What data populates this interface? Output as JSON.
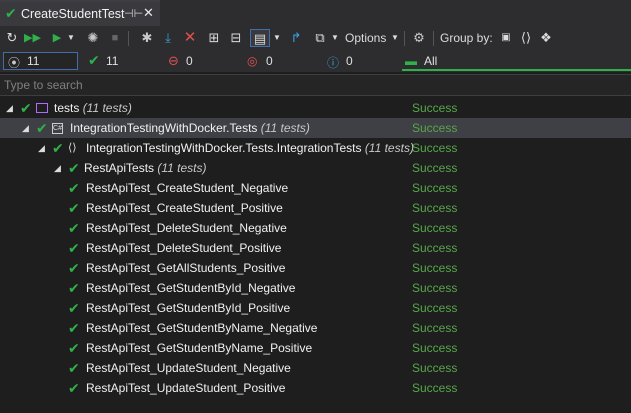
{
  "window": {
    "tab_title": "CreateStudentTest"
  },
  "toolbar": {
    "options_label": "Options",
    "group_by_label": "Group by:"
  },
  "summary": {
    "total": "11",
    "passed": "11",
    "failed": "0",
    "not_run": "0",
    "info": "0",
    "all_label": "All"
  },
  "search": {
    "placeholder": "Type to search"
  },
  "colors": {
    "success": "#57a64a",
    "pass_check": "#2fb14a",
    "selected_row": "#3f3f46"
  },
  "tree": [
    {
      "level": 0,
      "name": "tests",
      "count": "(11 tests)",
      "status": "Success",
      "icon": "project-icon",
      "expandable": true,
      "selected": false
    },
    {
      "level": 1,
      "name": "IntegrationTestingWithDocker.Tests",
      "count": "(11 tests)",
      "status": "Success",
      "icon": "csharp-project-icon",
      "expandable": true,
      "selected": true
    },
    {
      "level": 2,
      "name": "IntegrationTestingWithDocker.Tests.IntegrationTests",
      "count": "(11 tests)",
      "status": "Success",
      "icon": "namespace-icon",
      "expandable": true,
      "selected": false
    },
    {
      "level": 3,
      "name": "RestApiTests",
      "count": "(11 tests)",
      "status": "Success",
      "icon": "",
      "expandable": true,
      "selected": false
    },
    {
      "level": 4,
      "name": "RestApiTest_CreateStudent_Negative",
      "count": "",
      "status": "Success",
      "icon": "",
      "expandable": false,
      "selected": false
    },
    {
      "level": 4,
      "name": "RestApiTest_CreateStudent_Positive",
      "count": "",
      "status": "Success",
      "icon": "",
      "expandable": false,
      "selected": false
    },
    {
      "level": 4,
      "name": "RestApiTest_DeleteStudent_Negative",
      "count": "",
      "status": "Success",
      "icon": "",
      "expandable": false,
      "selected": false
    },
    {
      "level": 4,
      "name": "RestApiTest_DeleteStudent_Positive",
      "count": "",
      "status": "Success",
      "icon": "",
      "expandable": false,
      "selected": false
    },
    {
      "level": 4,
      "name": "RestApiTest_GetAllStudents_Positive",
      "count": "",
      "status": "Success",
      "icon": "",
      "expandable": false,
      "selected": false
    },
    {
      "level": 4,
      "name": "RestApiTest_GetStudentById_Negative",
      "count": "",
      "status": "Success",
      "icon": "",
      "expandable": false,
      "selected": false
    },
    {
      "level": 4,
      "name": "RestApiTest_GetStudentById_Positive",
      "count": "",
      "status": "Success",
      "icon": "",
      "expandable": false,
      "selected": false
    },
    {
      "level": 4,
      "name": "RestApiTest_GetStudentByName_Negative",
      "count": "",
      "status": "Success",
      "icon": "",
      "expandable": false,
      "selected": false
    },
    {
      "level": 4,
      "name": "RestApiTest_GetStudentByName_Positive",
      "count": "",
      "status": "Success",
      "icon": "",
      "expandable": false,
      "selected": false
    },
    {
      "level": 4,
      "name": "RestApiTest_UpdateStudent_Negative",
      "count": "",
      "status": "Success",
      "icon": "",
      "expandable": false,
      "selected": false
    },
    {
      "level": 4,
      "name": "RestApiTest_UpdateStudent_Positive",
      "count": "",
      "status": "Success",
      "icon": "",
      "expandable": false,
      "selected": false
    }
  ]
}
